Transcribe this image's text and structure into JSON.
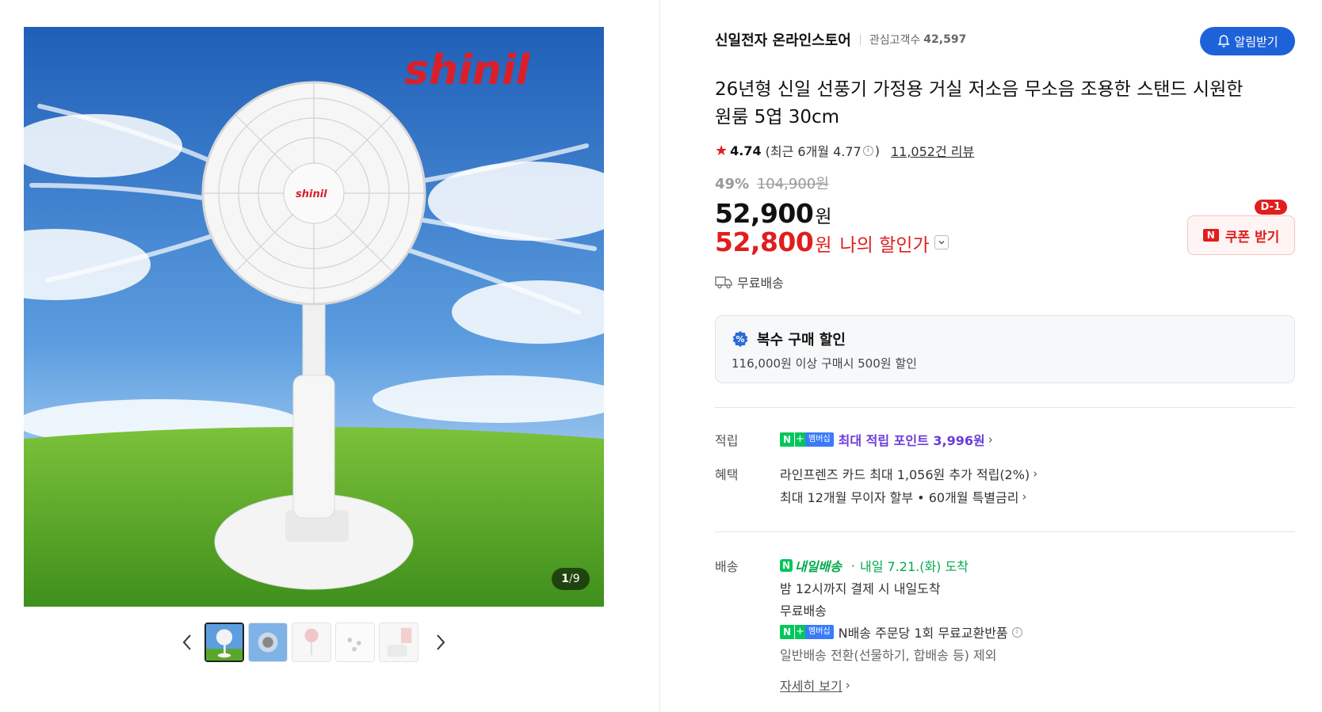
{
  "gallery": {
    "image_counter_current": "1",
    "image_counter_sep": "/",
    "image_counter_total": "9",
    "thumbnails": [
      "thumb-1",
      "thumb-2",
      "thumb-3",
      "thumb-4",
      "thumb-5"
    ],
    "brand_logo_text": "shinil"
  },
  "store": {
    "name": "신일전자 온라인스토어",
    "fans_label": "관심고객수",
    "fans_count": "42,597",
    "alarm_button": "알림받기"
  },
  "product": {
    "title": "26년형 신일 선풍기 가정용 거실 저소음 무소음 조용한 스탠드 시원한 원룸 5엽 30cm",
    "rating": "4.74",
    "recent_prefix": "(최근 6개월 4.77",
    "recent_suffix": ")",
    "review_link": "11,052건 리뷰",
    "discount_pct": "49%",
    "original_price": "104,900원",
    "price": "52,900",
    "price_unit": "원",
    "my_price": "52,800",
    "my_price_unit": "원",
    "my_price_label": "나의 할인가",
    "coupon_label": "쿠폰 받기",
    "coupon_dday": "D-1",
    "free_shipping": "무료배송"
  },
  "bulk": {
    "title": "복수 구매 할인",
    "desc": "116,000원 이상 구매시 500원 할인"
  },
  "points": {
    "label": "적립",
    "badge_n": "N",
    "badge_plus": "+",
    "badge_member": "멤버십",
    "text": "최대 적립 포인트 3,996원"
  },
  "benefits": {
    "label": "혜택",
    "line1": "라인프렌즈 카드 최대 1,056원 추가 적립(2%)",
    "line2": "최대 12개월 무이자 할부 • 60개월 특별금리"
  },
  "delivery": {
    "label": "배송",
    "badge_text": "내일배송",
    "dot": "·",
    "arrival": "내일 7.21.(화) 도착",
    "line2": "밤 12시까지 결제 시 내일도착",
    "line3": "무료배송",
    "line4": "N배송 주문당 1회 무료교환반품",
    "line5": "일반배송 전환(선물하기, 합배송 등) 제외",
    "detail_link": "자세히 보기"
  },
  "colors": {
    "accent_blue": "#1e62d9",
    "price_red": "#e01e1e",
    "naver_green": "#03c75a",
    "points_purple": "#6a3cd8"
  }
}
